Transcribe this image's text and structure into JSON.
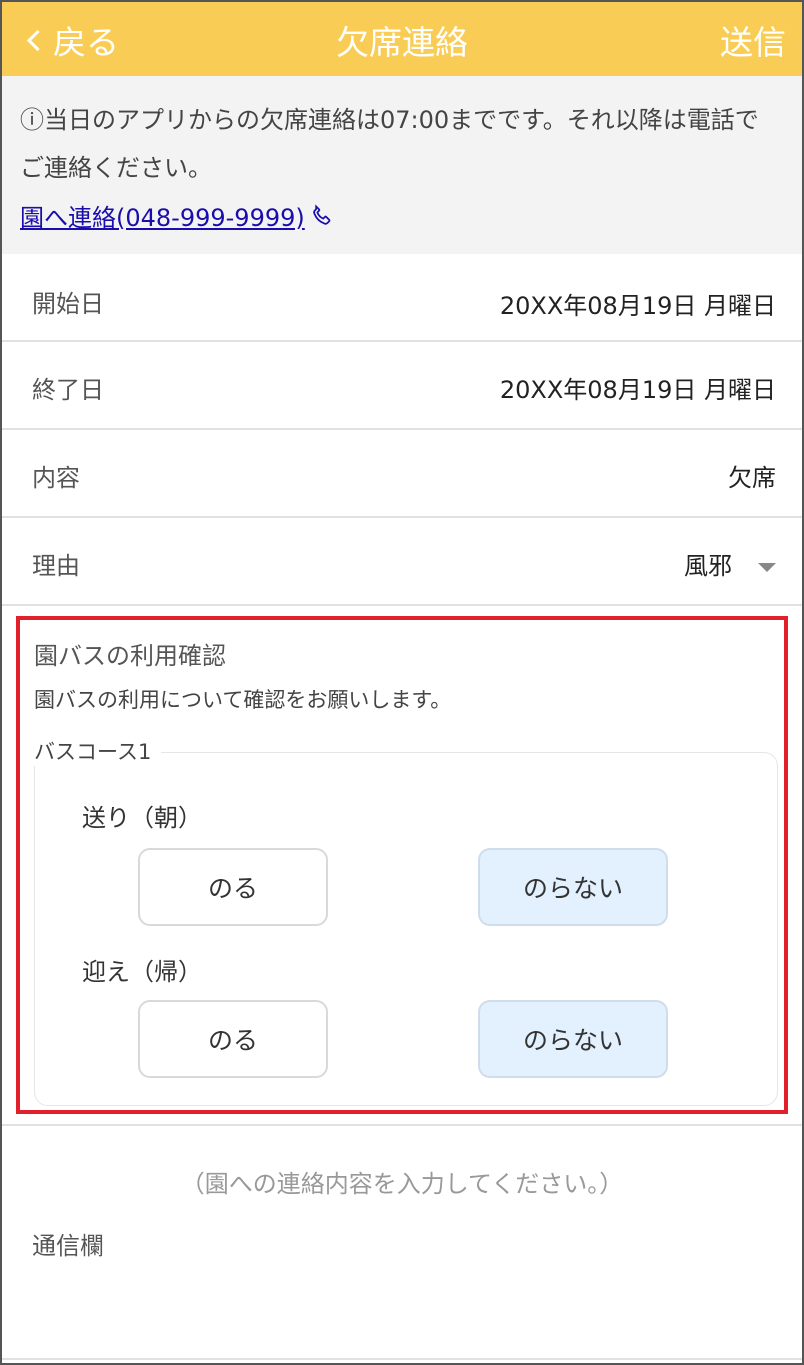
{
  "header": {
    "back_label": "戻る",
    "title": "欠席連絡",
    "send_label": "送信",
    "background_color": "#f9cd55"
  },
  "notice": {
    "text": "当日のアプリからの欠席連絡は07:00までです。それ以降は電話でご連絡ください。",
    "icon": "info-circle-icon",
    "link_text": "園へ連絡(048-999-9999)",
    "link_icon": "phone-icon"
  },
  "form": {
    "start_date": {
      "label": "開始日",
      "value": "20XX年08月19日 月曜日"
    },
    "end_date": {
      "label": "終了日",
      "value": "20XX年08月19日 月曜日"
    },
    "content": {
      "label": "内容",
      "value": "欠席"
    },
    "reason": {
      "label": "理由",
      "value": "風邪"
    }
  },
  "bus": {
    "title": "園バスの利用確認",
    "description": "園バスの利用について確認をお願いします。",
    "highlight_color": "#e0212b",
    "course_name": "バスコース1",
    "morning": {
      "label": "送り（朝）",
      "ride_label": "のる",
      "no_ride_label": "のらない",
      "selected": "のらない"
    },
    "evening": {
      "label": "迎え（帰）",
      "ride_label": "のる",
      "no_ride_label": "のらない",
      "selected": "のらない"
    }
  },
  "message": {
    "placeholder": "（園への連絡内容を入力してください。）",
    "label": "通信欄"
  }
}
